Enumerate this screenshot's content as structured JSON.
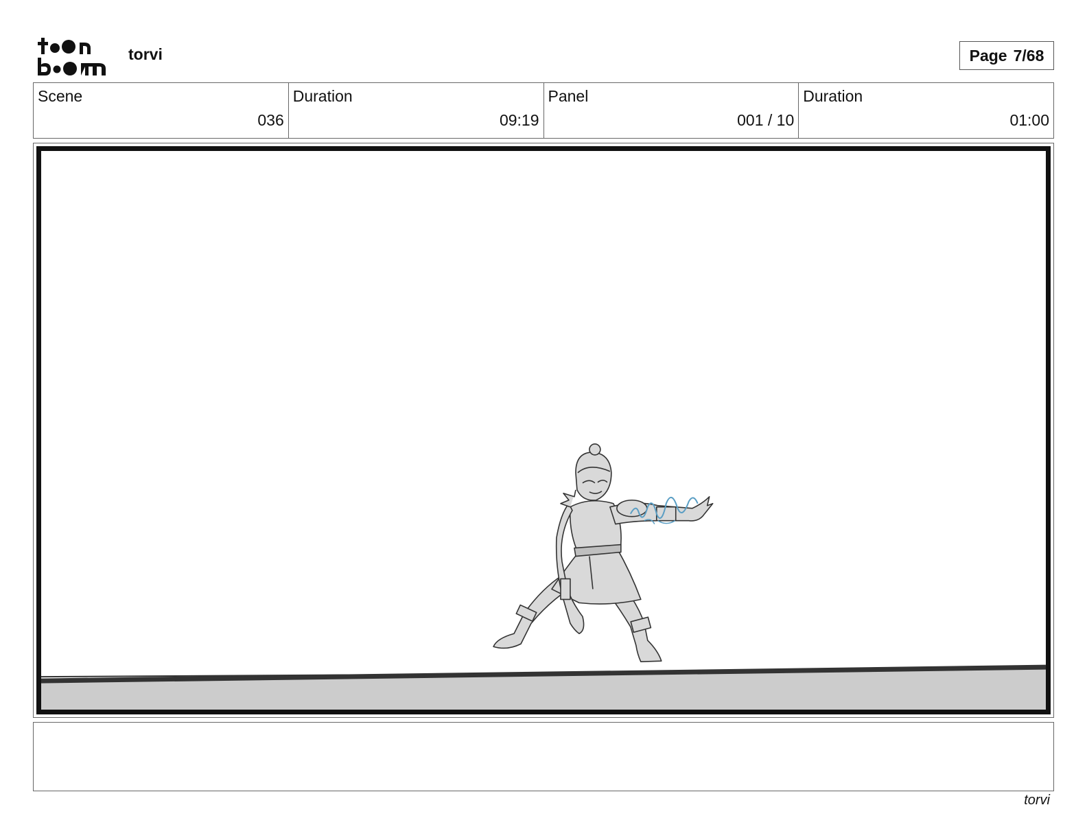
{
  "header": {
    "logo_name": "toonboom-logo",
    "project_title": "torvi",
    "page_label": "Page",
    "page_value": "7/68"
  },
  "info": {
    "scene_label": "Scene",
    "scene_value": "036",
    "scene_duration_label": "Duration",
    "scene_duration_value": "09:19",
    "panel_label": "Panel",
    "panel_value": "001 / 10",
    "panel_duration_label": "Duration",
    "panel_duration_value": "01:00"
  },
  "panel": {
    "image": "storyboard-sketch-character-crouching",
    "sketch_color": "#333333",
    "fill_color": "#d9d9d9",
    "ground_color": "#cccccc",
    "accent_color": "#5a9ec4"
  },
  "notes": {
    "text": ""
  },
  "footer": {
    "project_title": "torvi"
  }
}
